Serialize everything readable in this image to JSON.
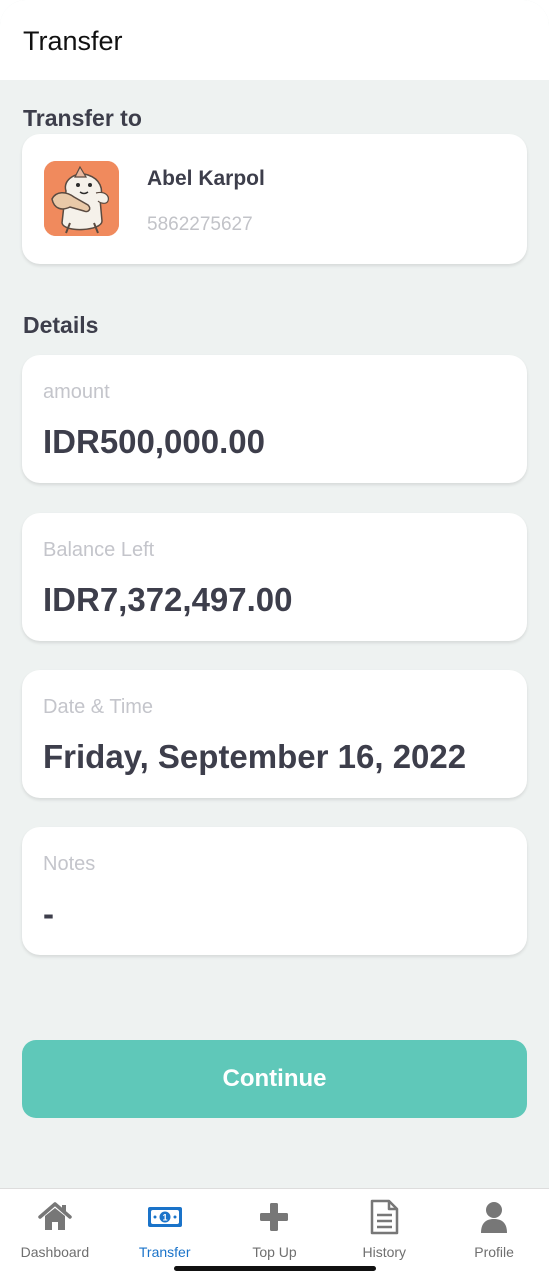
{
  "header": {
    "title": "Transfer"
  },
  "recipient_section": {
    "title": "Transfer to",
    "name": "Abel Karpol",
    "account_number": "5862275627",
    "avatar": "cartoon-character-avatar"
  },
  "details_section": {
    "title": "Details",
    "items": [
      {
        "label": "amount",
        "value": "IDR500,000.00"
      },
      {
        "label": "Balance Left",
        "value": "IDR7,372,497.00"
      },
      {
        "label": "Date & Time",
        "value": "Friday, September 16, 2022"
      },
      {
        "label": "Notes",
        "value": "-"
      }
    ]
  },
  "continue_label": "Continue",
  "nav": {
    "items": [
      {
        "label": "Dashboard",
        "icon": "home-icon",
        "active": false
      },
      {
        "label": "Transfer",
        "icon": "money-icon",
        "active": true
      },
      {
        "label": "Top Up",
        "icon": "plus-icon",
        "active": false
      },
      {
        "label": "History",
        "icon": "document-icon",
        "active": false
      },
      {
        "label": "Profile",
        "icon": "user-icon",
        "active": false
      }
    ]
  },
  "colors": {
    "accent": "#5fc8b9",
    "active_nav": "#1a73c9",
    "background": "#eef2f1"
  }
}
